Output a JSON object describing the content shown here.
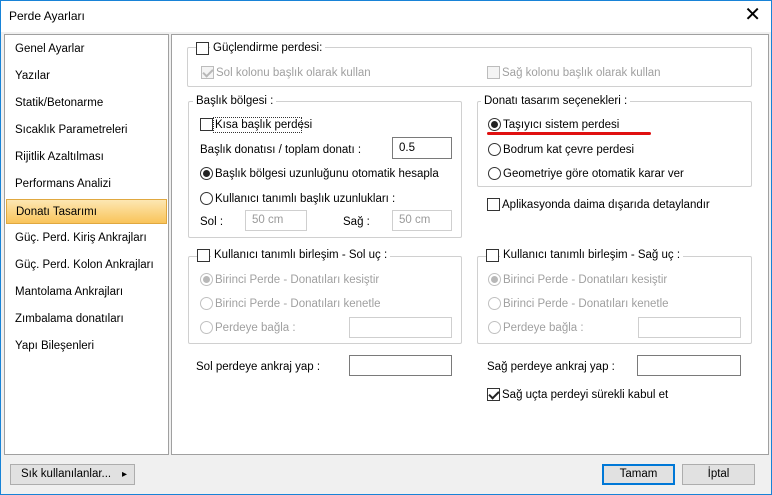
{
  "window": {
    "title": "Perde Ayarları",
    "close_glyph": "✕"
  },
  "sidebar": {
    "items": [
      {
        "label": "Genel Ayarlar"
      },
      {
        "label": "Yazılar"
      },
      {
        "label": "Statik/Betonarme"
      },
      {
        "label": "Sıcaklık Parametreleri"
      },
      {
        "label": "Rijitlik Azaltılması"
      },
      {
        "label": "Performans Analizi"
      },
      {
        "label": "Donatı Tasarımı",
        "selected": true
      },
      {
        "label": "Güç. Perd. Kiriş Ankrajları"
      },
      {
        "label": "Güç. Perd. Kolon Ankrajları"
      },
      {
        "label": "Mantolama Ankrajları"
      },
      {
        "label": "Zımbalama donatıları"
      },
      {
        "label": "Yapı Bileşenleri"
      }
    ]
  },
  "strengthening": {
    "label": "Güçlendirme perdesi:",
    "checked": false,
    "left_col_label": "Sol kolonu başlık olarak kullan",
    "left_col_checked": true,
    "right_col_label": "Sağ kolonu başlık olarak kullan",
    "right_col_checked": false
  },
  "header_region": {
    "title": "Başlık bölgesi :",
    "short_header_label": "Kısa başlık perdesi",
    "short_header_checked": false,
    "ratio_label": "Başlık donatısı / toplam donatı :",
    "ratio_value": "0.5",
    "auto_calc_label": "Başlık bölgesi uzunluğunu otomatik hesapla",
    "user_defined_label": "Kullanıcı tanımlı başlık uzunlukları :",
    "left_label": "Sol :",
    "left_value": "50 cm",
    "right_label": "Sağ :",
    "right_value": "50 cm"
  },
  "design_options": {
    "title": "Donatı tasarım seçenekleri :",
    "options": [
      {
        "label": "Taşıyıcı sistem perdesi",
        "selected": true
      },
      {
        "label": "Bodrum kat çevre perdesi",
        "selected": false
      },
      {
        "label": "Geometriye göre otomatik karar ver",
        "selected": false
      }
    ],
    "highlight_color": "#e01010"
  },
  "detail_in_application": {
    "label": "Aplikasyonda daima dışarıda detaylandır",
    "checked": false
  },
  "left_end": {
    "label": "Kullanıcı tanımlı birleşim - Sol uç :",
    "checked": false,
    "opt1": "Birinci Perde - Donatıları kesiştir",
    "opt2": "Birinci Perde - Donatıları kenetle",
    "opt3": "Perdeye bağla :"
  },
  "right_end": {
    "label": "Kullanıcı tanımlı birleşim - Sağ uç :",
    "checked": false,
    "opt1": "Birinci Perde - Donatıları kesiştir",
    "opt2": "Birinci Perde - Donatıları kenetle",
    "opt3": "Perdeye bağla :"
  },
  "anchors": {
    "left_label": "Sol perdeye ankraj yap :",
    "right_label": "Sağ perdeye ankraj yap :",
    "continuous_label": "Sağ uçta perdeyi sürekli kabul et",
    "continuous_checked": true
  },
  "footer": {
    "frequent_label": "Sık kullanılanlar...",
    "frequent_arrow": "▸",
    "ok_label": "Tamam",
    "cancel_label": "İptal"
  }
}
